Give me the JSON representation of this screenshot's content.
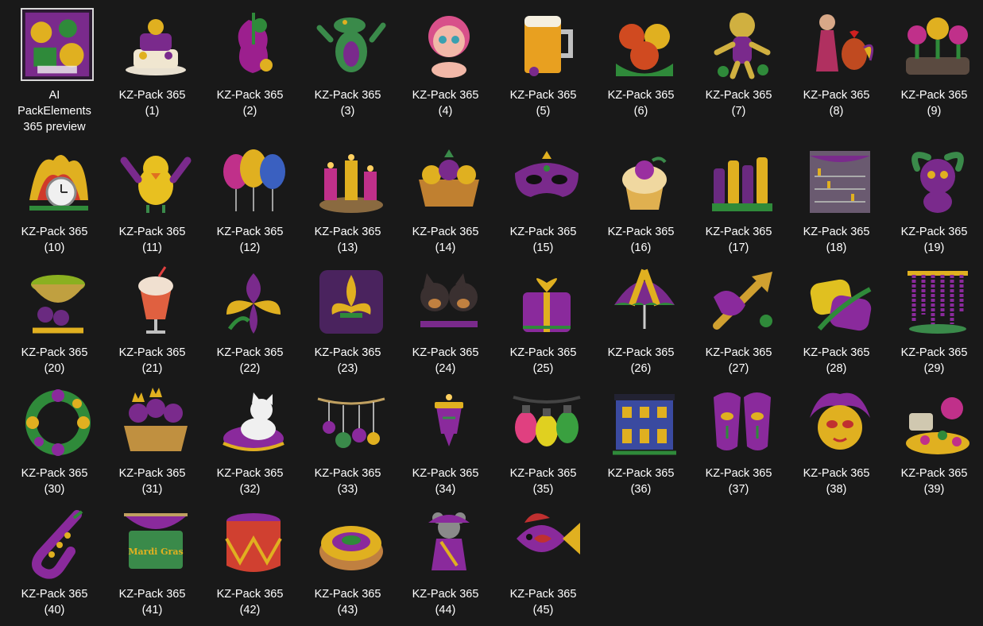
{
  "items": [
    {
      "label": "AI\nPackElements\n365 preview",
      "icon": "preview-collage-icon",
      "palette": [
        "#7a2a8c",
        "#e0b020",
        "#2f8a3a"
      ]
    },
    {
      "label": "KZ-Pack 365\n(1)",
      "icon": "cake-icon",
      "palette": [
        "#f0e6d0",
        "#7a2a8c",
        "#e0b020"
      ]
    },
    {
      "label": "KZ-Pack 365\n(2)",
      "icon": "violin-icon",
      "palette": [
        "#9c1f8e",
        "#e0b020",
        "#2f8a3a"
      ]
    },
    {
      "label": "KZ-Pack 365\n(3)",
      "icon": "alligator-icon",
      "palette": [
        "#3a8a4a",
        "#7a2a8c",
        "#e0b020"
      ]
    },
    {
      "label": "KZ-Pack 365\n(4)",
      "icon": "baby-icon",
      "palette": [
        "#f2b8a8",
        "#d8508a",
        "#3aa0b0"
      ]
    },
    {
      "label": "KZ-Pack 365\n(5)",
      "icon": "beer-mug-icon",
      "palette": [
        "#e8a020",
        "#c0c0c0",
        "#7a2a8c"
      ]
    },
    {
      "label": "KZ-Pack 365\n(6)",
      "icon": "masks-bouquet-icon",
      "palette": [
        "#d04a20",
        "#e0b020",
        "#2f8a3a"
      ]
    },
    {
      "label": "KZ-Pack 365\n(7)",
      "icon": "voodoo-doll-icon",
      "palette": [
        "#d0b040",
        "#7a2a8c",
        "#2f8a3a"
      ]
    },
    {
      "label": "KZ-Pack 365\n(8)",
      "icon": "girl-rooster-icon",
      "palette": [
        "#b03060",
        "#7a2a8c",
        "#e0b020"
      ]
    },
    {
      "label": "KZ-Pack 365\n(9)",
      "icon": "flower-bed-icon",
      "palette": [
        "#c0308a",
        "#e0b020",
        "#2f8a3a"
      ]
    },
    {
      "label": "KZ-Pack 365\n(10)",
      "icon": "clock-feathers-icon",
      "palette": [
        "#d03a2a",
        "#e0b020",
        "#2f8a3a"
      ]
    },
    {
      "label": "KZ-Pack 365\n(11)",
      "icon": "bird-icon",
      "palette": [
        "#e8c020",
        "#7a2a8c",
        "#3a8a4a"
      ]
    },
    {
      "label": "KZ-Pack 365\n(12)",
      "icon": "balloons-icon",
      "palette": [
        "#c0308a",
        "#e0b020",
        "#3a60c0"
      ]
    },
    {
      "label": "KZ-Pack 365\n(13)",
      "icon": "candles-icon",
      "palette": [
        "#8a6a40",
        "#c0308a",
        "#e0b020"
      ]
    },
    {
      "label": "KZ-Pack 365\n(14)",
      "icon": "fruit-basket-icon",
      "palette": [
        "#c08030",
        "#e0b020",
        "#7a2a8c"
      ]
    },
    {
      "label": "KZ-Pack 365\n(15)",
      "icon": "carnival-mask-icon",
      "palette": [
        "#7a2a8c",
        "#e0b020",
        "#2f8a3a"
      ]
    },
    {
      "label": "KZ-Pack 365\n(16)",
      "icon": "cupcake-icon",
      "palette": [
        "#e0b050",
        "#9a30a0",
        "#3a8a4a"
      ]
    },
    {
      "label": "KZ-Pack 365\n(17)",
      "icon": "bottles-icon",
      "palette": [
        "#6a2a80",
        "#e0b020",
        "#2f8a3a"
      ]
    },
    {
      "label": "KZ-Pack 365\n(18)",
      "icon": "bar-shelf-icon",
      "palette": [
        "#6a5a70",
        "#7a2a8c",
        "#e0b020"
      ]
    },
    {
      "label": "KZ-Pack 365\n(19)",
      "icon": "feather-creature-icon",
      "palette": [
        "#7a2a8c",
        "#e0b020",
        "#3a8a4a"
      ]
    },
    {
      "label": "KZ-Pack 365\n(20)",
      "icon": "punch-bowl-icon",
      "palette": [
        "#8ab020",
        "#6a2a80",
        "#e0b020"
      ]
    },
    {
      "label": "KZ-Pack 365\n(21)",
      "icon": "milkshake-icon",
      "palette": [
        "#f0e0d0",
        "#e06040",
        "#c0c0c0"
      ]
    },
    {
      "label": "KZ-Pack 365\n(22)",
      "icon": "iris-flower-icon",
      "palette": [
        "#7a2a8c",
        "#e0b020",
        "#2f8a3a"
      ]
    },
    {
      "label": "KZ-Pack 365\n(23)",
      "icon": "fleur-de-lis-icon",
      "palette": [
        "#6a2a8c",
        "#e0b020",
        "#2f8a3a"
      ]
    },
    {
      "label": "KZ-Pack 365\n(24)",
      "icon": "dogs-icon",
      "palette": [
        "#3a3030",
        "#c08040",
        "#7a2a8c"
      ]
    },
    {
      "label": "KZ-Pack 365\n(25)",
      "icon": "gift-box-icon",
      "palette": [
        "#8a2a9c",
        "#e0b020",
        "#2f8a3a"
      ]
    },
    {
      "label": "KZ-Pack 365\n(26)",
      "icon": "umbrella-icon",
      "palette": [
        "#7a2a8c",
        "#e0b020",
        "#2f8a3a"
      ]
    },
    {
      "label": "KZ-Pack 365\n(27)",
      "icon": "trumpet-icon",
      "palette": [
        "#d0a030",
        "#8a2a9c",
        "#2f8a3a"
      ]
    },
    {
      "label": "KZ-Pack 365\n(28)",
      "icon": "pillows-icon",
      "palette": [
        "#e0c020",
        "#8a2a9c",
        "#2f8a3a"
      ]
    },
    {
      "label": "KZ-Pack 365\n(29)",
      "icon": "beads-icon",
      "palette": [
        "#8a2a9c",
        "#e0b020",
        "#3a8a4a"
      ]
    },
    {
      "label": "KZ-Pack 365\n(30)",
      "icon": "wreath-icon",
      "palette": [
        "#8a2a9c",
        "#e0b020",
        "#2f8a3a"
      ]
    },
    {
      "label": "KZ-Pack 365\n(31)",
      "icon": "kings-basket-icon",
      "palette": [
        "#7a2a8c",
        "#c09040",
        "#e0b020"
      ]
    },
    {
      "label": "KZ-Pack 365\n(32)",
      "icon": "cat-icon",
      "palette": [
        "#f0f0f0",
        "#8a2a9c",
        "#e0b020"
      ]
    },
    {
      "label": "KZ-Pack 365\n(33)",
      "icon": "ornaments-garland-icon",
      "palette": [
        "#8a2a9c",
        "#e0b020",
        "#3a8a4a"
      ]
    },
    {
      "label": "KZ-Pack 365\n(34)",
      "icon": "lantern-icon",
      "palette": [
        "#8a2a9c",
        "#e0b020",
        "#3a8a4a"
      ]
    },
    {
      "label": "KZ-Pack 365\n(35)",
      "icon": "light-bulbs-icon",
      "palette": [
        "#e04080",
        "#e0d020",
        "#3aa040"
      ]
    },
    {
      "label": "KZ-Pack 365\n(36)",
      "icon": "house-icon",
      "palette": [
        "#3a4aa0",
        "#e0b020",
        "#2f8a3a"
      ]
    },
    {
      "label": "KZ-Pack 365\n(37)",
      "icon": "mask-pair-icon",
      "palette": [
        "#8a2a9c",
        "#e0b020",
        "#2f8a3a"
      ]
    },
    {
      "label": "KZ-Pack 365\n(38)",
      "icon": "feather-mask-icon",
      "palette": [
        "#c03030",
        "#8a2a9c",
        "#e0b020"
      ]
    },
    {
      "label": "KZ-Pack 365\n(39)",
      "icon": "treasure-pile-icon",
      "palette": [
        "#e0b020",
        "#c0308a",
        "#2f8a3a"
      ]
    },
    {
      "label": "KZ-Pack 365\n(40)",
      "icon": "saxophone-icon",
      "palette": [
        "#8a2a9c",
        "#e0b020",
        "#2f8a3a"
      ]
    },
    {
      "label": "KZ-Pack 365\n(41)",
      "icon": "mardi-gras-banner-icon",
      "palette": [
        "#8a2a9c",
        "#3a8a4a",
        "#e0b020"
      ]
    },
    {
      "label": "KZ-Pack 365\n(42)",
      "icon": "drum-icon",
      "palette": [
        "#d04030",
        "#e0b020",
        "#8a2a9c"
      ]
    },
    {
      "label": "KZ-Pack 365\n(43)",
      "icon": "king-cake-icon",
      "palette": [
        "#e0b020",
        "#8a2a9c",
        "#2f8a3a"
      ]
    },
    {
      "label": "KZ-Pack 365\n(44)",
      "icon": "mouse-icon",
      "palette": [
        "#8a8a8a",
        "#8a2a9c",
        "#e0b020"
      ]
    },
    {
      "label": "KZ-Pack 365\n(45)",
      "icon": "fish-icon",
      "palette": [
        "#e0b020",
        "#8a2a9c",
        "#c03030"
      ]
    }
  ]
}
